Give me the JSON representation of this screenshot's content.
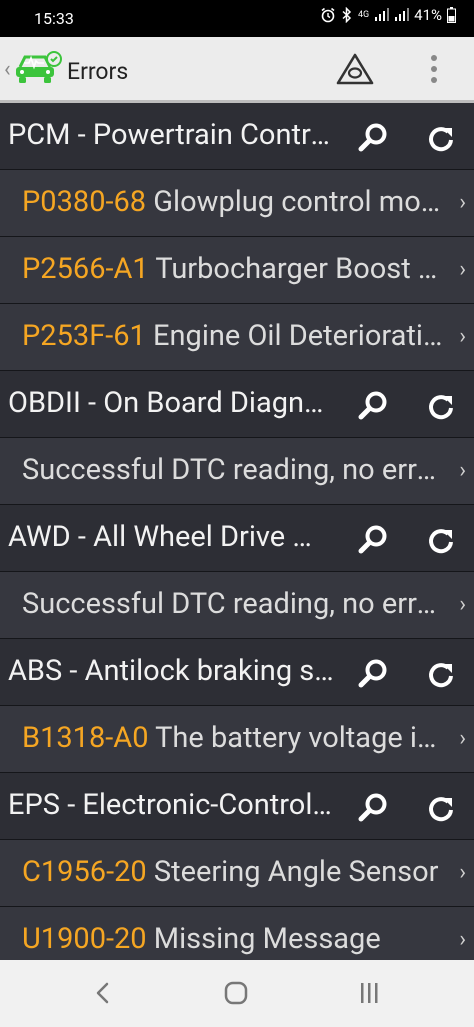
{
  "status_bar": {
    "time": "15:33",
    "network": "4G",
    "battery": "41%"
  },
  "header": {
    "title": "Errors"
  },
  "rows": [
    {
      "type": "header",
      "label": "PCM - Powertrain Control Module"
    },
    {
      "type": "item",
      "code": "P0380-68",
      "text": " Glowplug control module - event information"
    },
    {
      "type": "item",
      "code": "P2566-A1",
      "text": " Turbocharger Boost Control Position Sensor"
    },
    {
      "type": "item",
      "code": "P253F-61",
      "text": " Engine Oil Deterioration Level"
    },
    {
      "type": "header",
      "label": "OBDII - On Board Diagnostics"
    },
    {
      "type": "item",
      "code": "",
      "text": "Successful DTC reading, no errors found"
    },
    {
      "type": "header",
      "label": "AWD - All Wheel Drive Module"
    },
    {
      "type": "item",
      "code": "",
      "text": "Successful DTC reading, no errors found"
    },
    {
      "type": "header",
      "label": "ABS - Antilock braking system"
    },
    {
      "type": "item",
      "code": "B1318-A0",
      "text": " The battery voltage is low"
    },
    {
      "type": "header",
      "label": "EPS - Electronic-Controlled Power Steering"
    },
    {
      "type": "item",
      "code": "C1956-20",
      "text": " Steering Angle Sensor"
    },
    {
      "type": "item",
      "code": "U1900-20",
      "text": " Missing Message"
    }
  ],
  "colors": {
    "code": "#f5a623",
    "header_bg": "#2d2e35",
    "item_bg": "#36373f",
    "logo_green": "#3cc43c"
  }
}
